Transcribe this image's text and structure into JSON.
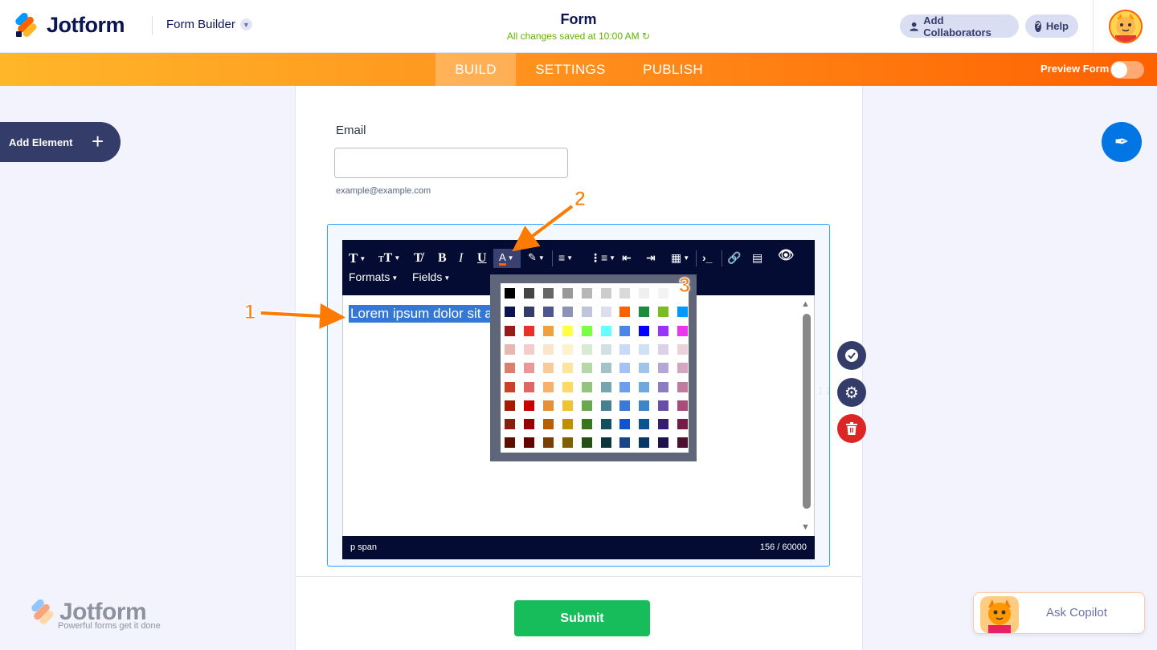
{
  "header": {
    "logo_text": "Jotform",
    "product": "Form Builder",
    "title": "Form",
    "saved_status": "All changes saved at 10:00 AM",
    "add_collaborators": "Add Collaborators",
    "help": "Help"
  },
  "nav": {
    "tabs": [
      {
        "label": "BUILD",
        "active": true
      },
      {
        "label": "SETTINGS",
        "active": false
      },
      {
        "label": "PUBLISH",
        "active": false
      }
    ],
    "preview_label": "Preview Form",
    "preview_on": false
  },
  "sidebar": {
    "add_element": "Add Element"
  },
  "form": {
    "email_label": "Email",
    "email_value": "",
    "email_sublabel": "example@example.com",
    "editor": {
      "toolbar_menus": [
        "Formats",
        "Fields"
      ],
      "selected_text": "Lorem ipsum dolor sit a",
      "status_path": "p  span",
      "char_count": "156 / 60000"
    },
    "submit_label": "Submit"
  },
  "color_picker": {
    "rows": [
      [
        "#000000",
        "#444444",
        "#666666",
        "#999999",
        "#b7b7b7",
        "#cccccc",
        "#d9d9d9",
        "#efefef",
        "#f3f3f3",
        "#ffffff"
      ],
      [
        "#0b1354",
        "#343c6a",
        "#4f568d",
        "#8b91b8",
        "#c1c4dc",
        "#dcdef0",
        "#ff6100",
        "#1a8d3a",
        "#78be20",
        "#0099ff"
      ],
      [
        "#981a1a",
        "#e9302a",
        "#f0a13f",
        "#ffff44",
        "#7aff44",
        "#66ffff",
        "#4a86e8",
        "#0000ff",
        "#9933ff",
        "#ee33ee"
      ],
      [
        "#e6b8af",
        "#f4cccc",
        "#fce5cd",
        "#fff2cc",
        "#d9ead3",
        "#d0e0e3",
        "#c9daf8",
        "#cfe2f3",
        "#d9d2e9",
        "#ead1dc"
      ],
      [
        "#dd7e6b",
        "#ea9999",
        "#f9cb9c",
        "#ffe599",
        "#b6d7a8",
        "#a2c4c9",
        "#a4c2f4",
        "#9fc5e8",
        "#b4a7d6",
        "#d5a6bd"
      ],
      [
        "#cc4125",
        "#e06666",
        "#f6b26b",
        "#ffd966",
        "#93c47d",
        "#76a5af",
        "#6d9eeb",
        "#6fa8dc",
        "#8e7cc3",
        "#c27ba0"
      ],
      [
        "#a61c00",
        "#cc0000",
        "#e69138",
        "#f1c232",
        "#6aa84f",
        "#45818e",
        "#3c78d8",
        "#3d85c6",
        "#674ea7",
        "#a64d79"
      ],
      [
        "#85200c",
        "#990000",
        "#b45f06",
        "#bf9000",
        "#38761d",
        "#134f5c",
        "#1155cc",
        "#0b5394",
        "#351c75",
        "#741b47"
      ],
      [
        "#5b0f00",
        "#660000",
        "#783f04",
        "#7f6000",
        "#274e13",
        "#0c343d",
        "#1c4587",
        "#073763",
        "#20124d",
        "#4c1130"
      ]
    ]
  },
  "annotations": [
    "1",
    "2",
    "3"
  ],
  "watermark": {
    "text": "Jotform",
    "tagline": "Powerful forms get it done"
  },
  "copilot": {
    "label": "Ask Copilot"
  },
  "colors": {
    "brand_orange": "#ff6100",
    "navy": "#0a1551",
    "submit_green": "#18bd5b",
    "selection_blue": "#3478d5"
  }
}
